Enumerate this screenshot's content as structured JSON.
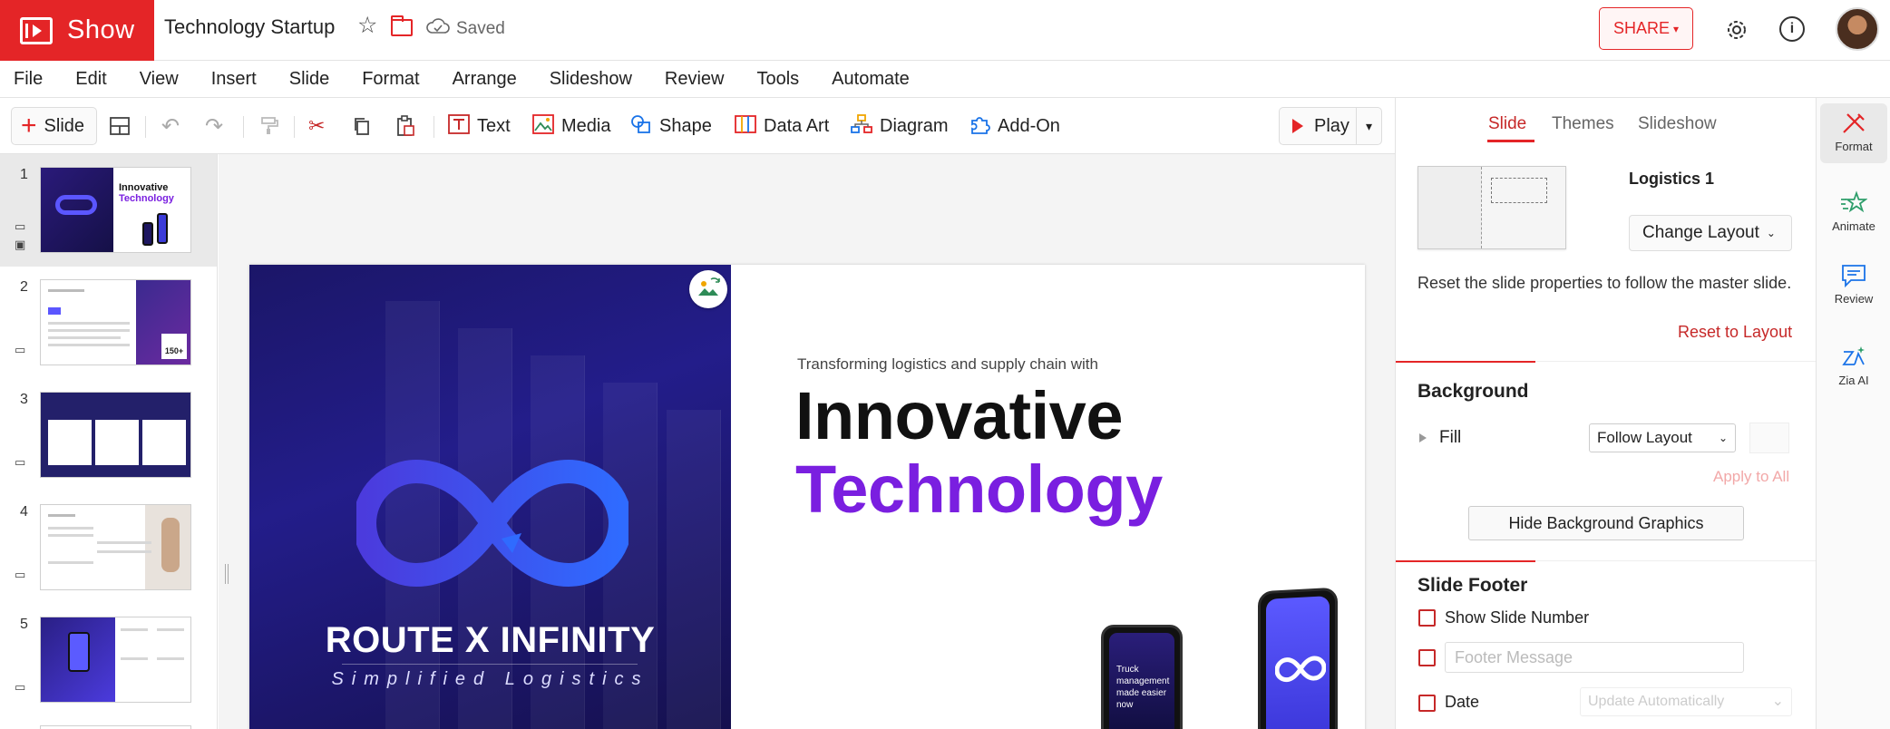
{
  "app": {
    "name": "Show",
    "doc_title": "Technology Startup",
    "save_status": "Saved"
  },
  "header": {
    "share_label": "SHARE"
  },
  "menu": [
    "File",
    "Edit",
    "View",
    "Insert",
    "Slide",
    "Format",
    "Arrange",
    "Slideshow",
    "Review",
    "Tools",
    "Automate"
  ],
  "toolbar": {
    "slide_label": "Slide",
    "text_label": "Text",
    "media_label": "Media",
    "shape_label": "Shape",
    "data_art_label": "Data Art",
    "diagram_label": "Diagram",
    "addon_label": "Add-On",
    "play_label": "Play"
  },
  "slides": [
    {
      "number": "1",
      "title": "Innovative",
      "title2": "Technology"
    },
    {
      "number": "2",
      "stat": "150+"
    },
    {
      "number": "3"
    },
    {
      "number": "4"
    },
    {
      "number": "5"
    }
  ],
  "slide": {
    "brand": "ROUTE X INFINITY",
    "tagline": "Simplified Logistics",
    "subheading": "Transforming logistics and supply chain with",
    "heading_line1": "Innovative",
    "heading_line2": "Technology",
    "phone_text": "Truck management made easier now",
    "colors": {
      "accent": "#7a1fe0",
      "panel": "#1b1668"
    }
  },
  "props": {
    "tabs": [
      "Slide",
      "Themes",
      "Slideshow"
    ],
    "active_tab": "Slide",
    "layout_name": "Logistics 1",
    "change_layout_label": "Change Layout",
    "reset_text": "Reset the slide properties to follow the master slide.",
    "reset_link": "Reset to Layout",
    "background_title": "Background",
    "fill_label": "Fill",
    "fill_value": "Follow Layout",
    "apply_all": "Apply to All",
    "hide_bg_label": "Hide Background Graphics",
    "footer_title": "Slide Footer",
    "show_slide_number": "Show Slide Number",
    "footer_placeholder": "Footer Message",
    "date_label": "Date",
    "date_value": "Update Automatically"
  },
  "rail": [
    {
      "label": "Format",
      "icon": "format-icon"
    },
    {
      "label": "Animate",
      "icon": "animate-icon"
    },
    {
      "label": "Review",
      "icon": "review-icon"
    },
    {
      "label": "Zia AI",
      "icon": "zia-ai-icon"
    }
  ],
  "theme": {
    "brand_red": "#e42527"
  }
}
